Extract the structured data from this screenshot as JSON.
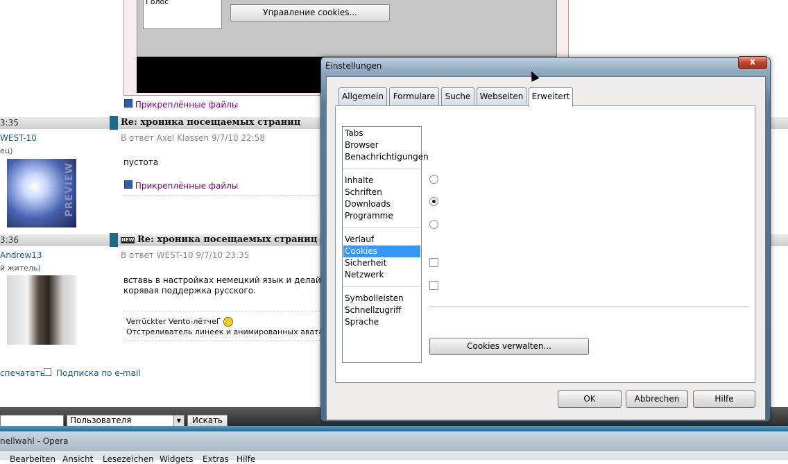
{
  "forum": {
    "top_panel": {
      "golos_label": "Голос",
      "manage_cookies_button": "Управление cookies..."
    },
    "attachments_label": "Прикреплённые файлы",
    "posts": [
      {
        "time": "3:35",
        "title": "Re: хроника посещаемых страниц",
        "reply_line": "В ответ Axel Klassen 9/7/10 22:58",
        "author": "WEST-10",
        "role": "ец)",
        "avatar_text": "PREVIEW",
        "body": [
          "пустота"
        ]
      },
      {
        "time": "3:36",
        "new_badge": "NEW",
        "title": "Re: хроника посещаемых страниц",
        "reply_line": "В ответ WEST-10 9/7/10 23:35",
        "author": "Andrew13",
        "role": "й житель)",
        "body": [
          "вставь в настройках немецкий язык и делай нас",
          "корявая поддержка русского."
        ],
        "signature": [
          "Verrückter Vento-лётчеГ",
          "Отстреливатель линеек и анимированных аватарок."
        ]
      }
    ],
    "print_link": "спечатать",
    "subscribe_link": "Подписка по e-mail",
    "search": {
      "select_value": "Пользователя",
      "button": "Искать"
    }
  },
  "opera": {
    "title": "nellwahl - Opera",
    "menu": [
      "Bearbeiten",
      "Ansicht",
      "Lesezeichen",
      "Widgets",
      "Extras",
      "Hilfe"
    ]
  },
  "dialog": {
    "title": "Einstellungen",
    "close": "x",
    "tabs": [
      "Allgemein",
      "Formulare",
      "Suche",
      "Webseiten",
      "Erweitert"
    ],
    "active_tab": "Erweitert",
    "categories": {
      "group1": [
        "Tabs",
        "Browser",
        "Benachrichtigungen"
      ],
      "group2": [
        "Inhalte",
        "Schriften",
        "Downloads",
        "Programme"
      ],
      "group3": [
        "Verlauf",
        "Cookies",
        "Sicherheit",
        "Netzwerk"
      ],
      "group4": [
        "Symbolleisten",
        "Schnellzugriff",
        "Sprache"
      ]
    },
    "selected_category": "Cookies",
    "options": {
      "radio_selected_index": 1,
      "radio_count": 3,
      "checkboxes_checked": [
        false,
        false
      ]
    },
    "manage_cookies_button": "Cookies verwalten...",
    "buttons": {
      "ok": "OK",
      "cancel": "Abbrechen",
      "help": "Hilfe"
    }
  }
}
